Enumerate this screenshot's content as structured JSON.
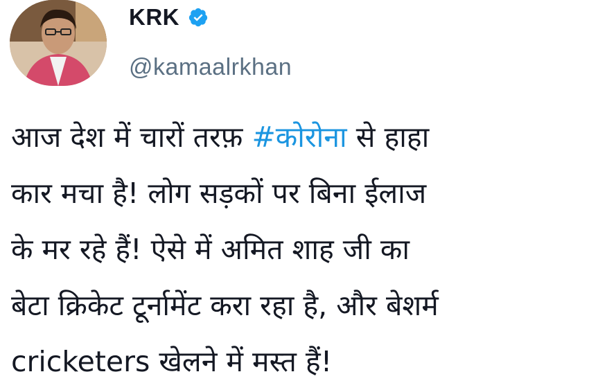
{
  "tweet": {
    "author": {
      "display_name": "KRK",
      "handle": "@kamaalrkhan",
      "verified_icon": "verified-badge-icon",
      "avatar_icon": "profile-avatar"
    },
    "lines": [
      {
        "before": "आज देश में चारों तरफ़ ",
        "hashtag": "#कोरोना",
        "after": " से हाहा"
      },
      {
        "text": "कार मचा है! लोग सड़कों पर बिना ईलाज"
      },
      {
        "text": "के मर रहे हैं! ऐसे में अमित शाह जी का"
      },
      {
        "text": "बेटा क्रिकेट टूर्नामेंट करा रहा है, और बेशर्म"
      },
      {
        "text": "cricketers खेलने में मस्त हैं!"
      }
    ],
    "colors": {
      "text": "#141823",
      "handle": "#5b7083",
      "hashtag": "#1b95e0",
      "verified": "#1da1f2"
    }
  }
}
